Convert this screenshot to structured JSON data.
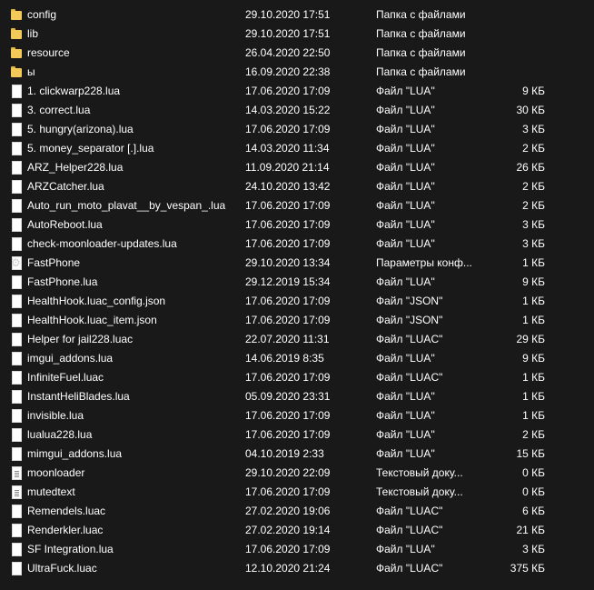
{
  "files": [
    {
      "name": "config",
      "date": "29.10.2020 17:51",
      "type": "Папка с файлами",
      "size": "",
      "icon": "folder-icon"
    },
    {
      "name": "lib",
      "date": "29.10.2020 17:51",
      "type": "Папка с файлами",
      "size": "",
      "icon": "folder-icon"
    },
    {
      "name": "resource",
      "date": "26.04.2020 22:50",
      "type": "Папка с файлами",
      "size": "",
      "icon": "folder-icon"
    },
    {
      "name": "ы",
      "date": "16.09.2020 22:38",
      "type": "Папка с файлами",
      "size": "",
      "icon": "folder-icon"
    },
    {
      "name": "1. clickwarp228.lua",
      "date": "17.06.2020 17:09",
      "type": "Файл \"LUA\"",
      "size": "9 КБ",
      "icon": "file-icon"
    },
    {
      "name": "3. correct.lua",
      "date": "14.03.2020 15:22",
      "type": "Файл \"LUA\"",
      "size": "30 КБ",
      "icon": "file-icon"
    },
    {
      "name": "5. hungry(arizona).lua",
      "date": "17.06.2020 17:09",
      "type": "Файл \"LUA\"",
      "size": "3 КБ",
      "icon": "file-icon"
    },
    {
      "name": "5. money_separator [.].lua",
      "date": "14.03.2020 11:34",
      "type": "Файл \"LUA\"",
      "size": "2 КБ",
      "icon": "file-icon"
    },
    {
      "name": "ARZ_Helper228.lua",
      "date": "11.09.2020 21:14",
      "type": "Файл \"LUA\"",
      "size": "26 КБ",
      "icon": "file-icon"
    },
    {
      "name": "ARZCatcher.lua",
      "date": "24.10.2020 13:42",
      "type": "Файл \"LUA\"",
      "size": "2 КБ",
      "icon": "file-icon"
    },
    {
      "name": "Auto_run_moto_plavat__by_vespan_.lua",
      "date": "17.06.2020 17:09",
      "type": "Файл \"LUA\"",
      "size": "2 КБ",
      "icon": "file-icon"
    },
    {
      "name": "AutoReboot.lua",
      "date": "17.06.2020 17:09",
      "type": "Файл \"LUA\"",
      "size": "3 КБ",
      "icon": "file-icon"
    },
    {
      "name": "check-moonloader-updates.lua",
      "date": "17.06.2020 17:09",
      "type": "Файл \"LUA\"",
      "size": "3 КБ",
      "icon": "file-icon"
    },
    {
      "name": "FastPhone",
      "date": "29.10.2020 13:34",
      "type": "Параметры конф...",
      "size": "1 КБ",
      "icon": "settings-file-icon"
    },
    {
      "name": "FastPhone.lua",
      "date": "29.12.2019 15:34",
      "type": "Файл \"LUA\"",
      "size": "9 КБ",
      "icon": "file-icon"
    },
    {
      "name": "HealthHook.luac_config.json",
      "date": "17.06.2020 17:09",
      "type": "Файл \"JSON\"",
      "size": "1 КБ",
      "icon": "file-icon"
    },
    {
      "name": "HealthHook.luac_item.json",
      "date": "17.06.2020 17:09",
      "type": "Файл \"JSON\"",
      "size": "1 КБ",
      "icon": "file-icon"
    },
    {
      "name": "Helper for jail228.luac",
      "date": "22.07.2020 11:31",
      "type": "Файл \"LUAC\"",
      "size": "29 КБ",
      "icon": "file-icon"
    },
    {
      "name": "imgui_addons.lua",
      "date": "14.06.2019 8:35",
      "type": "Файл \"LUA\"",
      "size": "9 КБ",
      "icon": "file-icon"
    },
    {
      "name": "InfiniteFuel.luac",
      "date": "17.06.2020 17:09",
      "type": "Файл \"LUAC\"",
      "size": "1 КБ",
      "icon": "file-icon"
    },
    {
      "name": "InstantHeliBlades.lua",
      "date": "05.09.2020 23:31",
      "type": "Файл \"LUA\"",
      "size": "1 КБ",
      "icon": "file-icon"
    },
    {
      "name": "invisible.lua",
      "date": "17.06.2020 17:09",
      "type": "Файл \"LUA\"",
      "size": "1 КБ",
      "icon": "file-icon"
    },
    {
      "name": "lualua228.lua",
      "date": "17.06.2020 17:09",
      "type": "Файл \"LUA\"",
      "size": "2 КБ",
      "icon": "file-icon"
    },
    {
      "name": "mimgui_addons.lua",
      "date": "04.10.2019 2:33",
      "type": "Файл \"LUA\"",
      "size": "15 КБ",
      "icon": "file-icon"
    },
    {
      "name": "moonloader",
      "date": "29.10.2020 22:09",
      "type": "Текстовый доку...",
      "size": "0 КБ",
      "icon": "text-document-icon"
    },
    {
      "name": "mutedtext",
      "date": "17.06.2020 17:09",
      "type": "Текстовый доку...",
      "size": "0 КБ",
      "icon": "text-document-icon"
    },
    {
      "name": "Remendels.luac",
      "date": "27.02.2020 19:06",
      "type": "Файл \"LUAC\"",
      "size": "6 КБ",
      "icon": "file-icon"
    },
    {
      "name": "Renderkler.luac",
      "date": "27.02.2020 19:14",
      "type": "Файл \"LUAC\"",
      "size": "21 КБ",
      "icon": "file-icon"
    },
    {
      "name": "SF Integration.lua",
      "date": "17.06.2020 17:09",
      "type": "Файл \"LUA\"",
      "size": "3 КБ",
      "icon": "file-icon"
    },
    {
      "name": "UltraFuck.luac",
      "date": "12.10.2020 21:24",
      "type": "Файл \"LUAC\"",
      "size": "375 КБ",
      "icon": "file-icon"
    }
  ]
}
